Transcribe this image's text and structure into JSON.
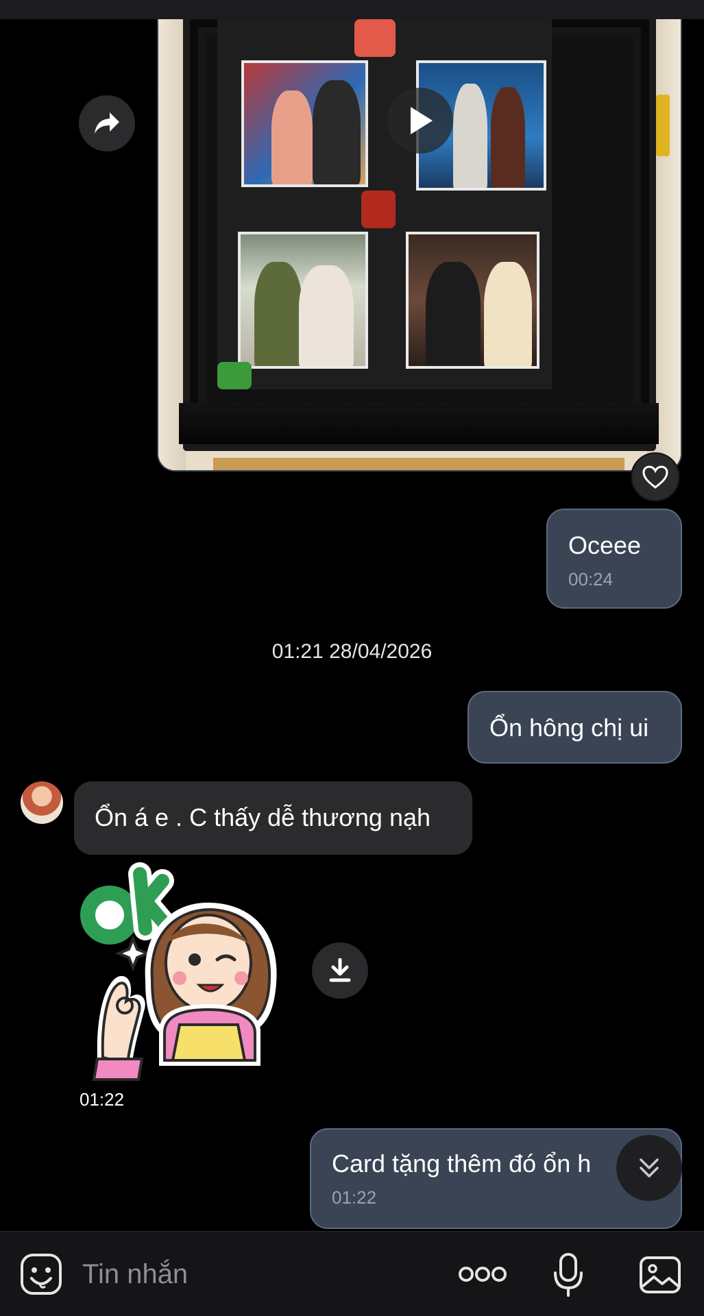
{
  "video_message": {
    "content": "photo-frame-video",
    "play_icon": "play-icon",
    "forward_icon": "share-forward-icon",
    "heart_icon": "heart-outline-icon"
  },
  "messages": [
    {
      "side": "out",
      "text": "Oceee",
      "time": "00:24"
    },
    {
      "side": "divider",
      "text": "01:21 28/04/2026"
    },
    {
      "side": "out",
      "text": "Ổn hông chị ui"
    },
    {
      "side": "in",
      "text": "Ổn á e . C thấy dễ thương nạh"
    },
    {
      "side": "in",
      "type": "sticker",
      "sticker_text": "OK",
      "time": "01:22",
      "download_icon": "download-icon"
    },
    {
      "side": "out",
      "text": "Card tặng thêm đó ổn h",
      "time": "01:22"
    }
  ],
  "scroll_down_icon": "double-chevron-down-icon",
  "composer": {
    "placeholder": "Tin nhắn",
    "emoji_icon": "emoji-smile-icon",
    "more_icon": "more-dots-icon",
    "mic_icon": "microphone-icon",
    "image_icon": "image-gallery-icon"
  },
  "colors": {
    "background": "#000000",
    "outgoing_bubble": "#3a4454",
    "incoming_bubble": "#2b2b2e",
    "composer": "#151517"
  }
}
